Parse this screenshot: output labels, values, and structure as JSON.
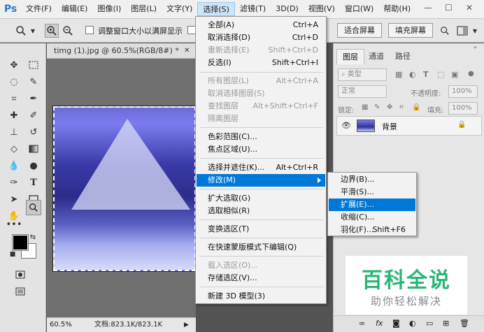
{
  "app": {
    "logo": "Ps"
  },
  "menubar": {
    "items": [
      "文件(F)",
      "编辑(E)",
      "图像(I)",
      "图层(L)",
      "文字(Y)",
      "选择(S)",
      "滤镜(T)",
      "3D(D)",
      "视图(V)",
      "窗口(W)",
      "帮助(H)"
    ],
    "active_index": 5,
    "window_controls": {
      "minimize": "—",
      "maximize": "☐",
      "close": "✕"
    }
  },
  "options_bar": {
    "resize_window_label": "调整窗口大小以满屏显示",
    "fit_screen_label": "适合屏幕",
    "fill_screen_label": "填充屏幕"
  },
  "document": {
    "tab_title": "timg (1).jpg @ 60.5%(RGB/8#) *",
    "close_icon": "✕",
    "zoom": "60.5%",
    "doc_info": "文档:823.1K/823.1K"
  },
  "layers_panel": {
    "tabs": [
      "图层",
      "通道",
      "路径"
    ],
    "active_tab": 0,
    "filter_kind": "类型",
    "blend_mode": "正常",
    "opacity_label": "不透明度:",
    "opacity_value": "100%",
    "lock_label": "锁定:",
    "fill_label": "填充:",
    "fill_value": "100%",
    "layer_name": "背景"
  },
  "select_menu": {
    "items": [
      {
        "label": "全部(A)",
        "shortcut": "Ctrl+A",
        "disabled": false
      },
      {
        "label": "取消选择(D)",
        "shortcut": "Ctrl+D",
        "disabled": false
      },
      {
        "label": "重新选择(E)",
        "shortcut": "Shift+Ctrl+D",
        "disabled": true
      },
      {
        "label": "反选(I)",
        "shortcut": "Shift+Ctrl+I",
        "disabled": false
      },
      {
        "label": "所有图层(L)",
        "shortcut": "Alt+Ctrl+A",
        "disabled": true
      },
      {
        "label": "取消选择图层(S)",
        "shortcut": "",
        "disabled": true
      },
      {
        "label": "查找图层",
        "shortcut": "Alt+Shift+Ctrl+F",
        "disabled": true
      },
      {
        "label": "隔离图层",
        "shortcut": "",
        "disabled": true
      },
      {
        "label": "色彩范围(C)...",
        "shortcut": "",
        "disabled": false
      },
      {
        "label": "焦点区域(U)...",
        "shortcut": "",
        "disabled": false
      },
      {
        "label": "选择并遮住(K)...",
        "shortcut": "Alt+Ctrl+R",
        "disabled": false
      },
      {
        "label": "修改(M)",
        "shortcut": "",
        "disabled": false
      },
      {
        "label": "扩大选取(G)",
        "shortcut": "",
        "disabled": false
      },
      {
        "label": "选取相似(R)",
        "shortcut": "",
        "disabled": false
      },
      {
        "label": "变换选区(T)",
        "shortcut": "",
        "disabled": false
      },
      {
        "label": "在快速蒙版模式下编辑(Q)",
        "shortcut": "",
        "disabled": false
      },
      {
        "label": "载入选区(O)...",
        "shortcut": "",
        "disabled": true
      },
      {
        "label": "存储选区(V)...",
        "shortcut": "",
        "disabled": false
      },
      {
        "label": "新建 3D 模型(3)",
        "shortcut": "",
        "disabled": false
      }
    ]
  },
  "modify_submenu": {
    "items": [
      {
        "label": "边界(B)...",
        "shortcut": ""
      },
      {
        "label": "平滑(S)...",
        "shortcut": ""
      },
      {
        "label": "扩展(E)...",
        "shortcut": ""
      },
      {
        "label": "收缩(C)...",
        "shortcut": ""
      },
      {
        "label": "羽化(F)...",
        "shortcut": "Shift+F6"
      }
    ],
    "highlighted_index": 2
  },
  "watermark": {
    "title": "百科全说",
    "subtitle": "助你轻松解决"
  }
}
